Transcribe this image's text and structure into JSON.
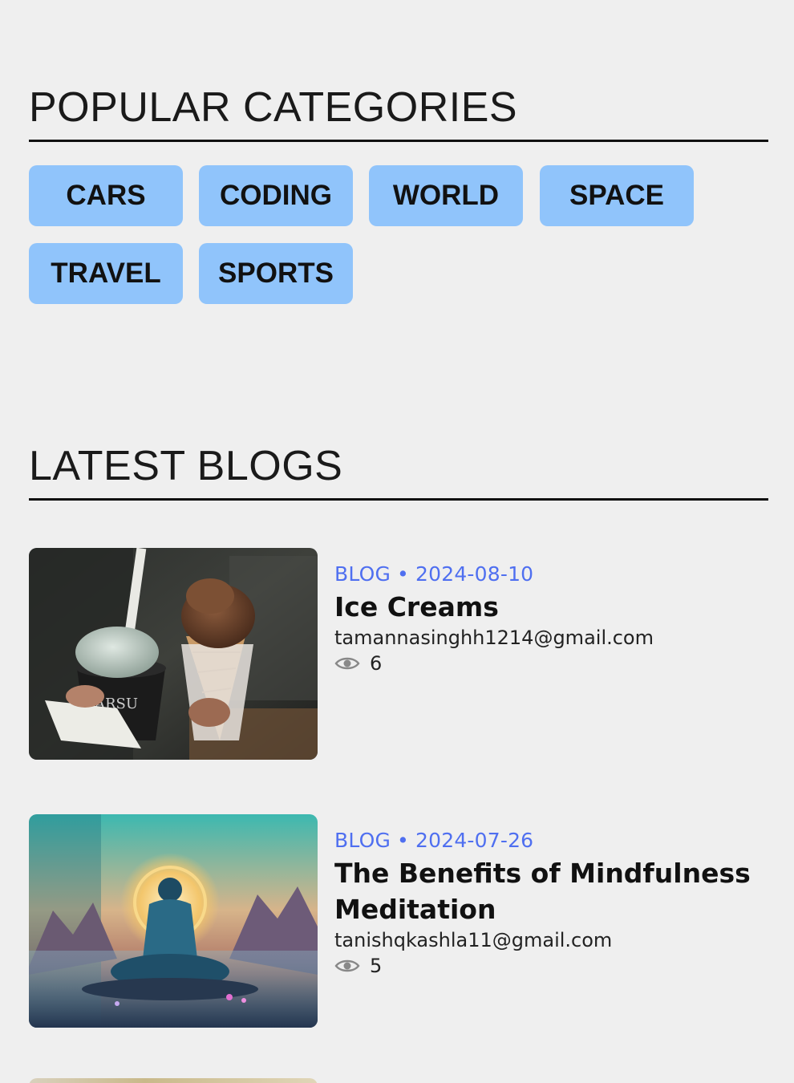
{
  "categories": {
    "title": "POPULAR CATEGORIES",
    "items": [
      "CARS",
      "CODING",
      "WORLD",
      "SPACE",
      "TRAVEL",
      "SPORTS"
    ],
    "chip_color": "#90c4fb"
  },
  "latest": {
    "title": "LATEST BLOGS",
    "posts": [
      {
        "category": "BLOG",
        "separator": "•",
        "date": "2024-08-10",
        "title": "Ice Creams",
        "author": "tamannasinghh1214@gmail.com",
        "views": "6",
        "image": "ice-cream-photo"
      },
      {
        "category": "BLOG",
        "separator": "•",
        "date": "2024-07-26",
        "title": "The Benefits of Mindfulness Meditation",
        "author": "tanishqkashla11@gmail.com",
        "views": "5",
        "image": "meditation-illustration"
      }
    ]
  },
  "colors": {
    "background": "#efefef",
    "meta_accent": "#4f6ff0"
  },
  "icons": {
    "views": "eye-icon"
  }
}
